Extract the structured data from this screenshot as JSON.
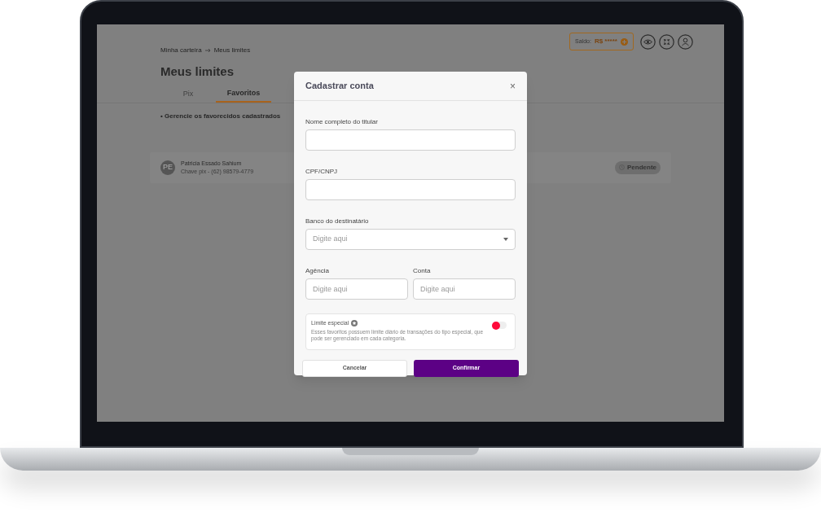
{
  "header": {
    "balance_label": "Saldo:",
    "balance_value": "R$ *****"
  },
  "breadcrumb": [
    "Minha carteira",
    "Meus limites"
  ],
  "title": "Meus limites",
  "tabs": [
    {
      "label": "Pix",
      "selected": false
    },
    {
      "label": "Favoritos",
      "selected": true
    }
  ],
  "section_note": "• Gerencie os favorecidos cadastrados",
  "favorites": [
    {
      "initials": "PE",
      "name": "Patricia Essado Sahium",
      "detail": "Chave pix - (62) 98579-4779",
      "status": "Pendente"
    }
  ],
  "modal": {
    "title": "Cadastrar conta",
    "close": "×",
    "fields": [
      {
        "label": "Nome completo do titular",
        "kind": "text"
      },
      {
        "label": "CPF/CNPJ",
        "kind": "text"
      },
      {
        "label": "Banco do destinatário",
        "kind": "select",
        "placeholder": "Digite aqui"
      }
    ],
    "pair": [
      {
        "label": "Agência",
        "placeholder": "Digite aqui"
      },
      {
        "label": "Conta",
        "placeholder": "Digite aqui"
      }
    ],
    "special": {
      "label": "Limite especial",
      "description": "Esses favoritos possuem limite diário de transações do tipo especial, que pode ser gerenciado em cada categoria.",
      "on": false
    },
    "cancel": "Cancelar",
    "confirm": "Confirmar"
  }
}
